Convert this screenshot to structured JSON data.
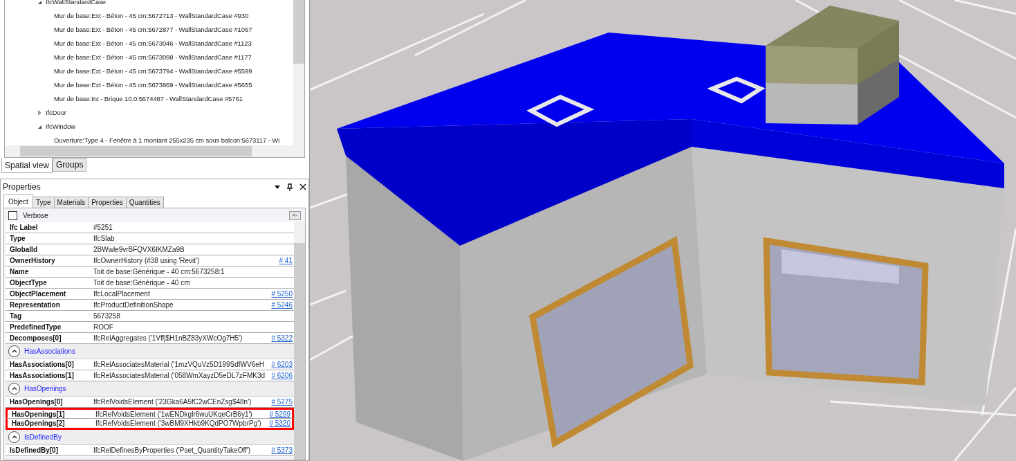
{
  "tree": {
    "items": [
      {
        "label": "IfcWallStandardCase",
        "expanded": true,
        "children": [
          {
            "label": "Mur de base:Ext - Béton - 45 cm:5672713 - WallStandardCase #930"
          },
          {
            "label": "Mur de base:Ext - Béton - 45 cm:5672877 - WallStandardCase #1067"
          },
          {
            "label": "Mur de base:Ext - Béton - 45 cm:5673046 - WallStandardCase #1123"
          },
          {
            "label": "Mur de base:Ext - Béton - 45 cm:5673098 - WallStandardCase #1177"
          },
          {
            "label": "Mur de base:Ext - Béton - 45 cm:5673794 - WallStandardCase #5599"
          },
          {
            "label": "Mur de base:Ext - Béton - 45 cm:5673869 - WallStandardCase #5655"
          },
          {
            "label": "Mur de base:Int - Brique 10.0:5674487 - WallStandardCase #5761"
          }
        ]
      },
      {
        "label": "IfcDoor",
        "expanded": false
      },
      {
        "label": "IfcWindow",
        "expanded": true,
        "children": [
          {
            "label": "Ouverture:Type 4 - Fenêtre à 1 montant 255x235 cm sous balcon:5673117 - Wi"
          }
        ]
      }
    ]
  },
  "view_tabs": [
    {
      "label": "Spatial view",
      "selected": true
    },
    {
      "label": "Groups",
      "selected": false
    }
  ],
  "properties": {
    "title": "Properties",
    "tabs": [
      {
        "label": "Object",
        "selected": true
      },
      {
        "label": "Type",
        "selected": false
      },
      {
        "label": "Materials",
        "selected": false
      },
      {
        "label": "Properties",
        "selected": false
      },
      {
        "label": "Quantities",
        "selected": false
      }
    ],
    "verbose": {
      "label": "Verbose",
      "checked": false
    },
    "back_button": "<-",
    "rows": [
      {
        "kind": "row",
        "name": "Ifc Label",
        "value": "#5251",
        "highlighted": false
      },
      {
        "kind": "row",
        "name": "Type",
        "value": "IfcSlab",
        "highlighted": false
      },
      {
        "kind": "row",
        "name": "GlobalId",
        "value": "2BWwle9vrBFQVX6IKMZa9B",
        "highlighted": false
      },
      {
        "kind": "row",
        "name": "OwnerHistory",
        "value": "IfcOwnerHistory (#38 using 'Revit')",
        "link": "# 41",
        "highlighted": false
      },
      {
        "kind": "row",
        "name": "Name",
        "value": "Toit de base:Générique  - 40 cm:5673258:1",
        "highlighted": false
      },
      {
        "kind": "row",
        "name": "ObjectType",
        "value": "Toit de base:Générique  - 40 cm",
        "highlighted": false
      },
      {
        "kind": "row",
        "name": "ObjectPlacement",
        "value": "IfcLocalPlacement",
        "link": "# 5250",
        "highlighted": false
      },
      {
        "kind": "row",
        "name": "Representation",
        "value": "IfcProductDefinitionShape",
        "link": "# 5246",
        "highlighted": false
      },
      {
        "kind": "row",
        "name": "Tag",
        "value": "5673258",
        "highlighted": false
      },
      {
        "kind": "row",
        "name": "PredefinedType",
        "value": "ROOF",
        "highlighted": false
      },
      {
        "kind": "row",
        "name": "Decomposes[0]",
        "value": "IfcRelAggregates ('1Vffj$H1nBZ83yXWcOg7H5')",
        "link": "# 5322",
        "highlighted": false
      },
      {
        "kind": "group",
        "name": "HasAssociations",
        "highlighted": false
      },
      {
        "kind": "row",
        "name": "HasAssociations[0]",
        "value": "IfcRelAssociatesMaterial ('1mzVQuVz5D199SdfWV6eH",
        "link": "# 6203",
        "highlighted": false
      },
      {
        "kind": "row",
        "name": "HasAssociations[1]",
        "value": "IfcRelAssociatesMaterial ('058WmXayzD5eDL7zFMK3d",
        "link": "# 6206",
        "highlighted": false
      },
      {
        "kind": "group",
        "name": "HasOpenings",
        "highlighted": false
      },
      {
        "kind": "row",
        "name": "HasOpenings[0]",
        "value": "IfcRelVoidsElement ('23Gka6A5fC2wCEnZsg$48n')",
        "link": "# 5275",
        "highlighted": false
      },
      {
        "kind": "row",
        "name": "HasOpenings[1]",
        "value": "IfcRelVoidsElement ('1wENDkglr6wuUKqeCrB6y1')",
        "link": "# 5299",
        "highlighted": true
      },
      {
        "kind": "row",
        "name": "HasOpenings[2]",
        "value": "IfcRelVoidsElement ('3wBM9XHkb9KQdPO7WpbrPg')",
        "link": "# 5320",
        "highlighted": true
      },
      {
        "kind": "group",
        "name": "IsDefinedBy",
        "highlighted": false
      },
      {
        "kind": "row",
        "name": "IsDefinedBy[0]",
        "value": "IfcRelDefinesByProperties ('Pset_QuantityTakeOff')",
        "link": "# 5373",
        "highlighted": false
      }
    ]
  }
}
